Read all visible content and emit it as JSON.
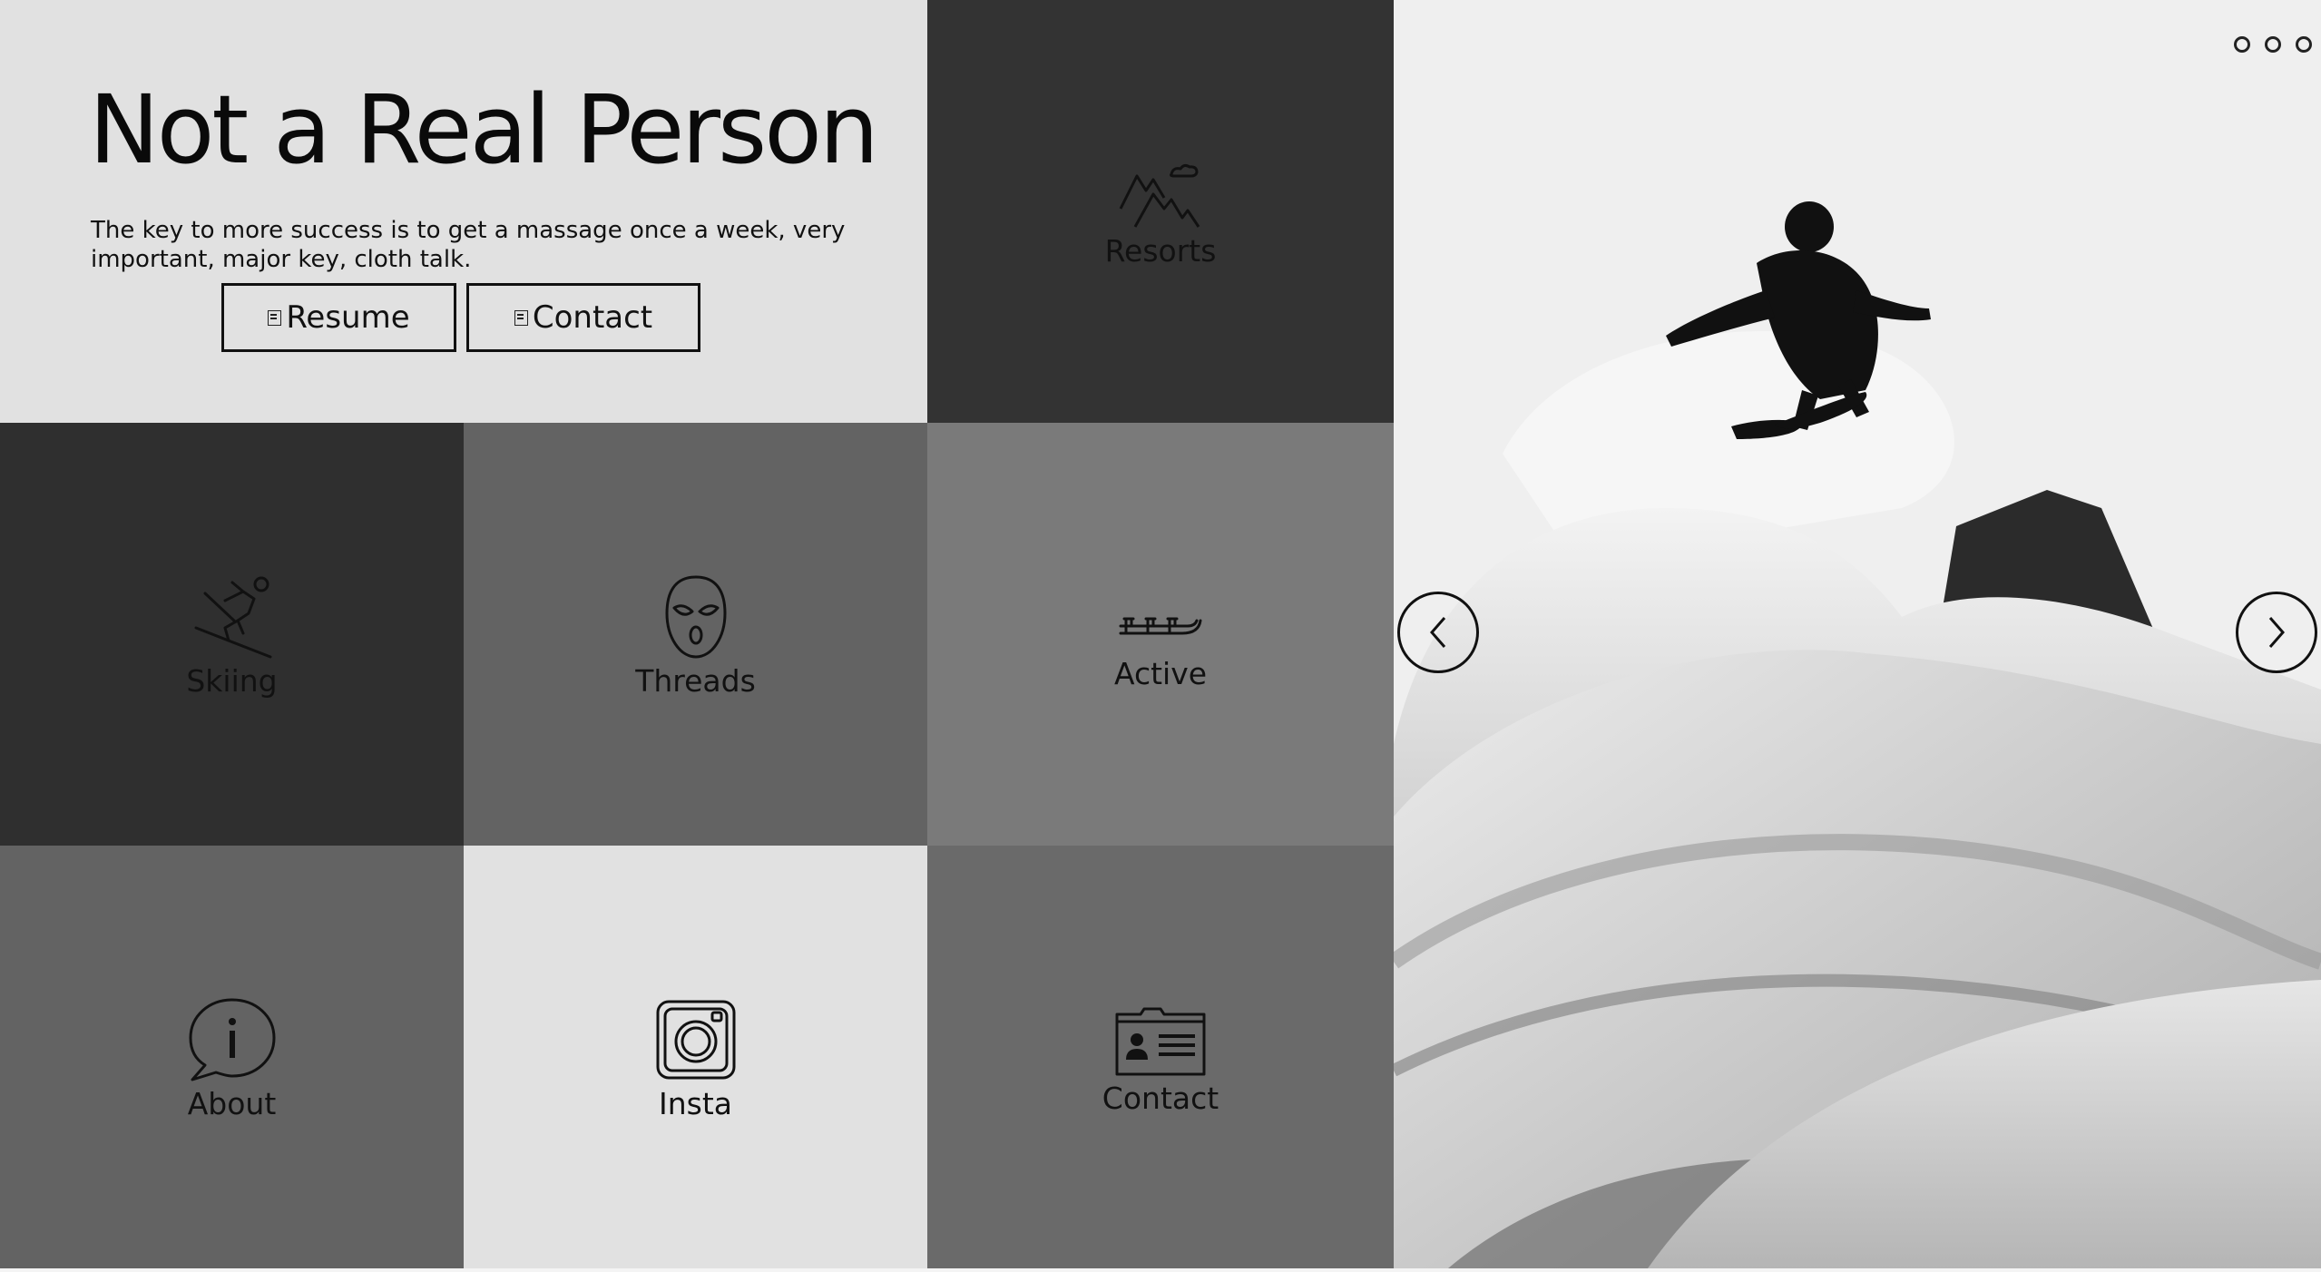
{
  "intro": {
    "title": "Not a Real Person",
    "tagline": "The key to more success is to get a massage once a week, very important, major key, cloth talk.",
    "resume_label": "Resume",
    "contact_label": "Contact"
  },
  "tiles": {
    "resorts": {
      "label": "Resorts",
      "icon": "mountains-icon",
      "color": "#333333"
    },
    "skiing": {
      "label": "Skiing",
      "icon": "skier-icon",
      "color": "#2f2f2f"
    },
    "threads": {
      "label": "Threads",
      "icon": "ski-mask-icon",
      "color": "#636363"
    },
    "active": {
      "label": "Active",
      "icon": "sled-icon",
      "color": "#7a7a7a"
    },
    "about": {
      "label": "About",
      "icon": "info-bubble-icon",
      "color": "#636363"
    },
    "insta": {
      "label": "Insta",
      "icon": "instagram-icon",
      "color": "#e1e1e1"
    },
    "contact": {
      "label": "Contact",
      "icon": "contact-card-icon",
      "color": "#6a6a6a"
    }
  },
  "slider": {
    "image": "backcountry skier jumping off snow pillow",
    "dots": 3,
    "prev_icon": "chevron-left-icon",
    "next_icon": "chevron-right-icon"
  }
}
